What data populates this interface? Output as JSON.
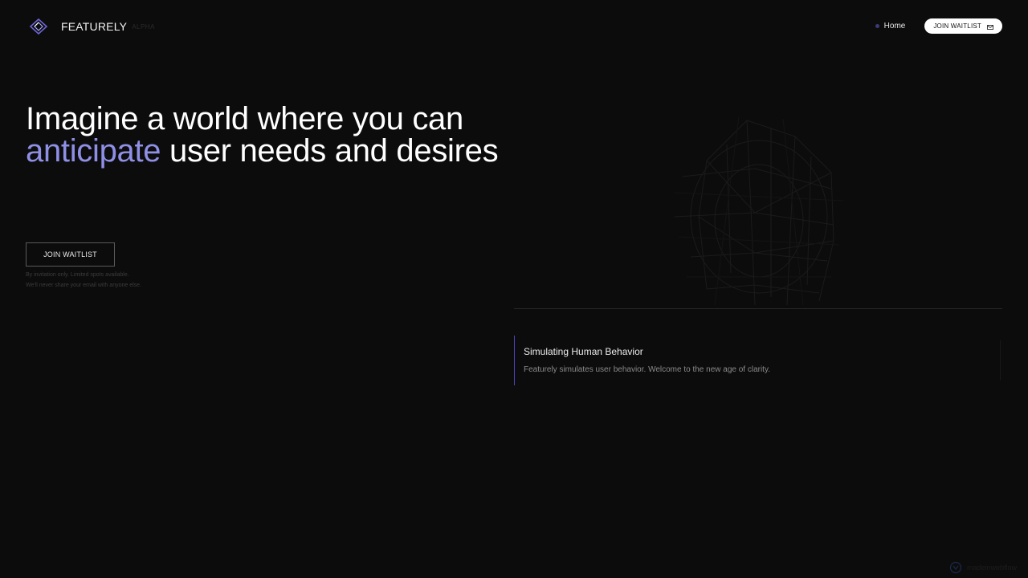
{
  "header": {
    "brand": "FEATURELY",
    "badge": "ALPHA",
    "nav": {
      "home_label": "Home",
      "cta_label": "JOIN WAITLIST"
    }
  },
  "hero": {
    "title_line1": "Imagine a world where you can",
    "title_accent": "anticipate",
    "title_rest": " user needs and desires",
    "cta_label": "JOIN WAITLIST",
    "note_line1": "By invitation only. Limited spots available.",
    "note_line2": "We'll never share your email with anyone else."
  },
  "feature": {
    "title": "Simulating Human Behavior",
    "description": "Featurely simulates user behavior. Welcome to the new age of clarity."
  },
  "watermark": {
    "label": "madeinwebflow"
  },
  "colors": {
    "background": "#0c0c0c",
    "accent": "#8f8fe6",
    "accent_line": "#4a46b8",
    "nav_dot": "#3b3a7a",
    "text": "#ffffff",
    "muted": "#8a8a8a"
  },
  "icons": {
    "logo": "diamond-logo-icon",
    "mail": "mail-icon",
    "watermark": "badge-icon"
  }
}
